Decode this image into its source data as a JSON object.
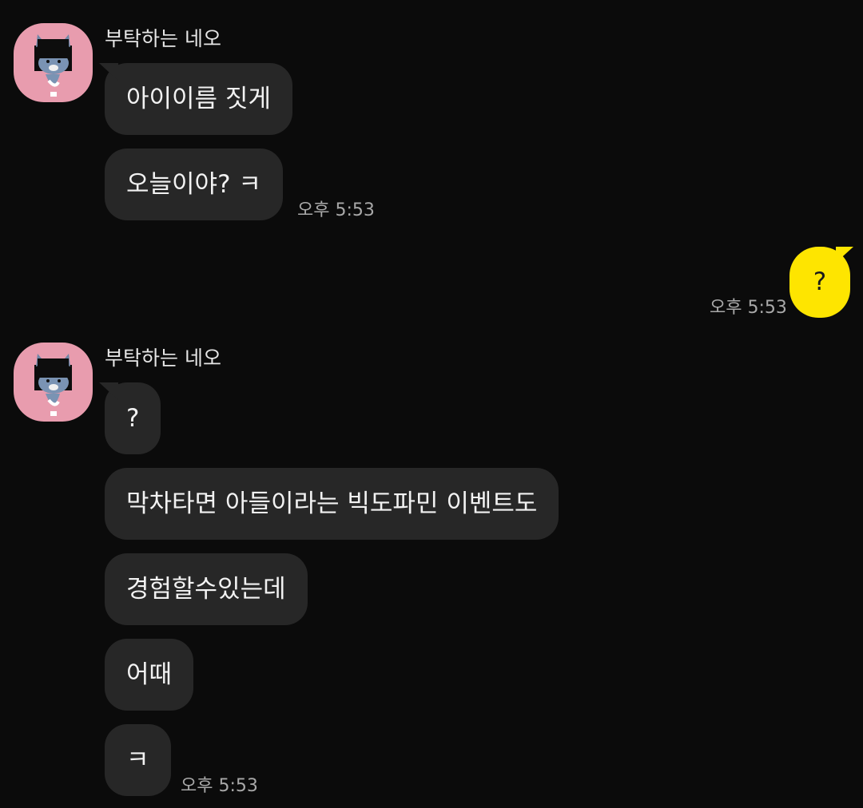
{
  "groups": [
    {
      "sender": "부탁하는 네오",
      "messages": [
        "아이이름 짓게",
        "오늘이야? ㅋ"
      ],
      "time": "오후 5:53"
    },
    {
      "mine": true,
      "messages": [
        "?"
      ],
      "time": "오후 5:53"
    },
    {
      "sender": "부탁하는 네오",
      "messages": [
        "?",
        "막차타면 아들이라는 빅도파민 이벤트도",
        "경험할수있는데",
        "어때",
        "ㅋ"
      ],
      "time": "오후 5:53"
    }
  ],
  "colors": {
    "background": "#0b0b0b",
    "incoming_bubble": "#272727",
    "outgoing_bubble": "#fee500",
    "avatar_bg": "#e89cae"
  },
  "icons": {
    "avatar": "neo-character-avatar-icon"
  }
}
